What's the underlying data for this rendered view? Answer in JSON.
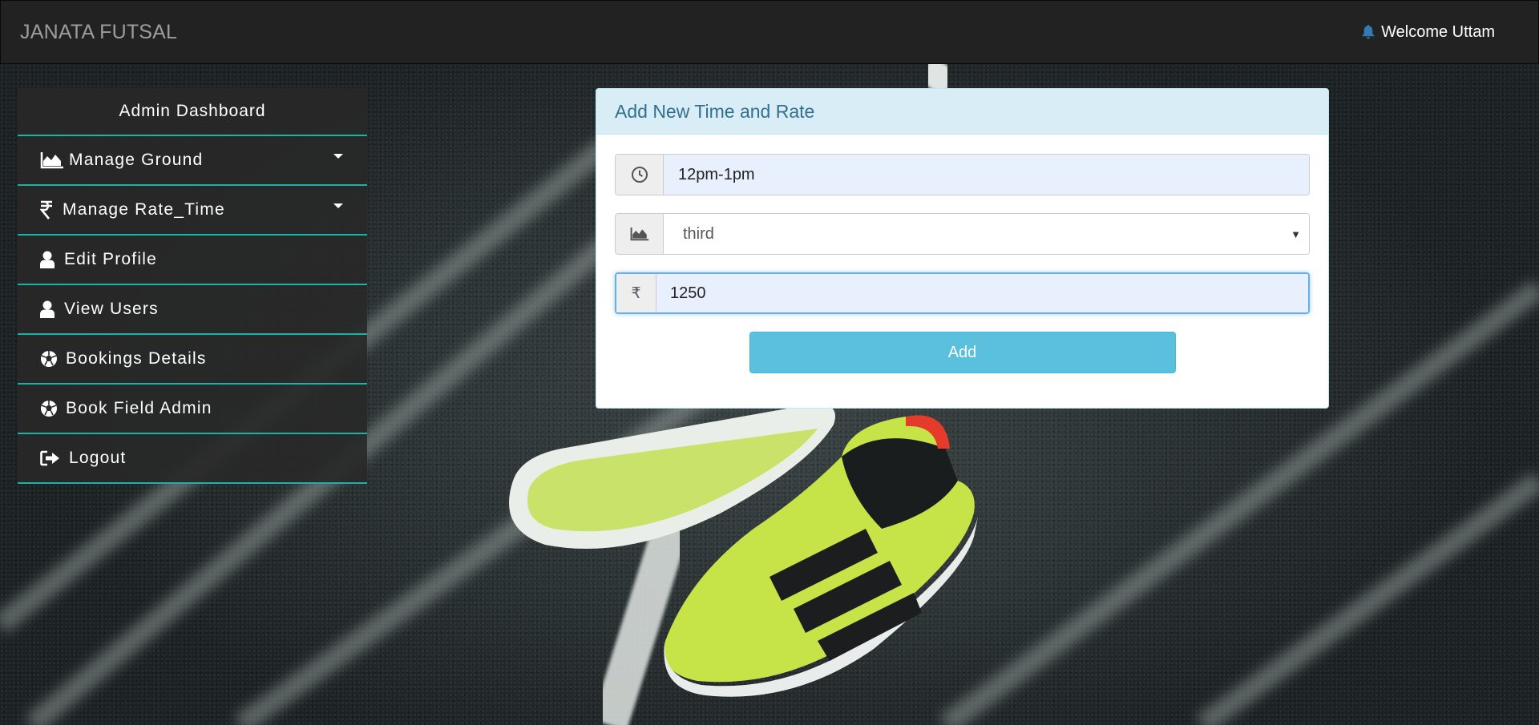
{
  "navbar": {
    "brand": "JANATA FUTSAL",
    "welcome": "Welcome Uttam"
  },
  "sidebar": {
    "title": "Admin Dashboard",
    "items": [
      {
        "label": "Manage Ground",
        "icon": "area-chart-icon",
        "dropdown": true
      },
      {
        "label": "Manage Rate_Time",
        "icon": "rupee-icon",
        "dropdown": true
      },
      {
        "label": "Edit Profile",
        "icon": "user-icon",
        "dropdown": false
      },
      {
        "label": "View Users",
        "icon": "user-icon",
        "dropdown": false
      },
      {
        "label": "Bookings Details",
        "icon": "soccer-ball-icon",
        "dropdown": false
      },
      {
        "label": "Book Field Admin",
        "icon": "soccer-ball-icon",
        "dropdown": false
      },
      {
        "label": "Logout",
        "icon": "sign-out-icon",
        "dropdown": false
      }
    ]
  },
  "form": {
    "title": "Add New Time and Rate",
    "time_value": "12pm-1pm",
    "ground_value": "third",
    "rate_value": "1250",
    "rupee_symbol": "₹",
    "submit_label": "Add"
  },
  "colors": {
    "navbar_bg": "#222222",
    "accent_border": "#1ab3a8",
    "panel_heading_bg": "#d9edf7",
    "panel_heading_text": "#31708f",
    "button_bg": "#5bc0de",
    "bell": "#337ab7"
  }
}
